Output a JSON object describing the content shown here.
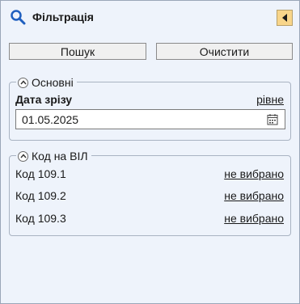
{
  "header": {
    "title": "Фільтрація",
    "search_icon": "search-icon",
    "collapse_icon": "collapse-left-icon",
    "collapse_color": "#f8d58a"
  },
  "toolbar": {
    "search_label": "Пошук",
    "clear_label": "Очистити"
  },
  "main_group": {
    "title": "Основні",
    "field_label": "Дата зрізу",
    "field_mode": "рівне",
    "date_value": "01.05.2025",
    "calendar_icon": "calendar-icon"
  },
  "vil_group": {
    "title": "Код на ВІЛ",
    "rows": [
      {
        "label": "Код 109.1",
        "value": "не вибрано"
      },
      {
        "label": "Код 109.2",
        "value": "не вибрано"
      },
      {
        "label": "Код 109.3",
        "value": "не вибрано"
      }
    ]
  },
  "colors": {
    "panel_bg": "#eef3fb",
    "icon_blue": "#1f5fbf"
  }
}
